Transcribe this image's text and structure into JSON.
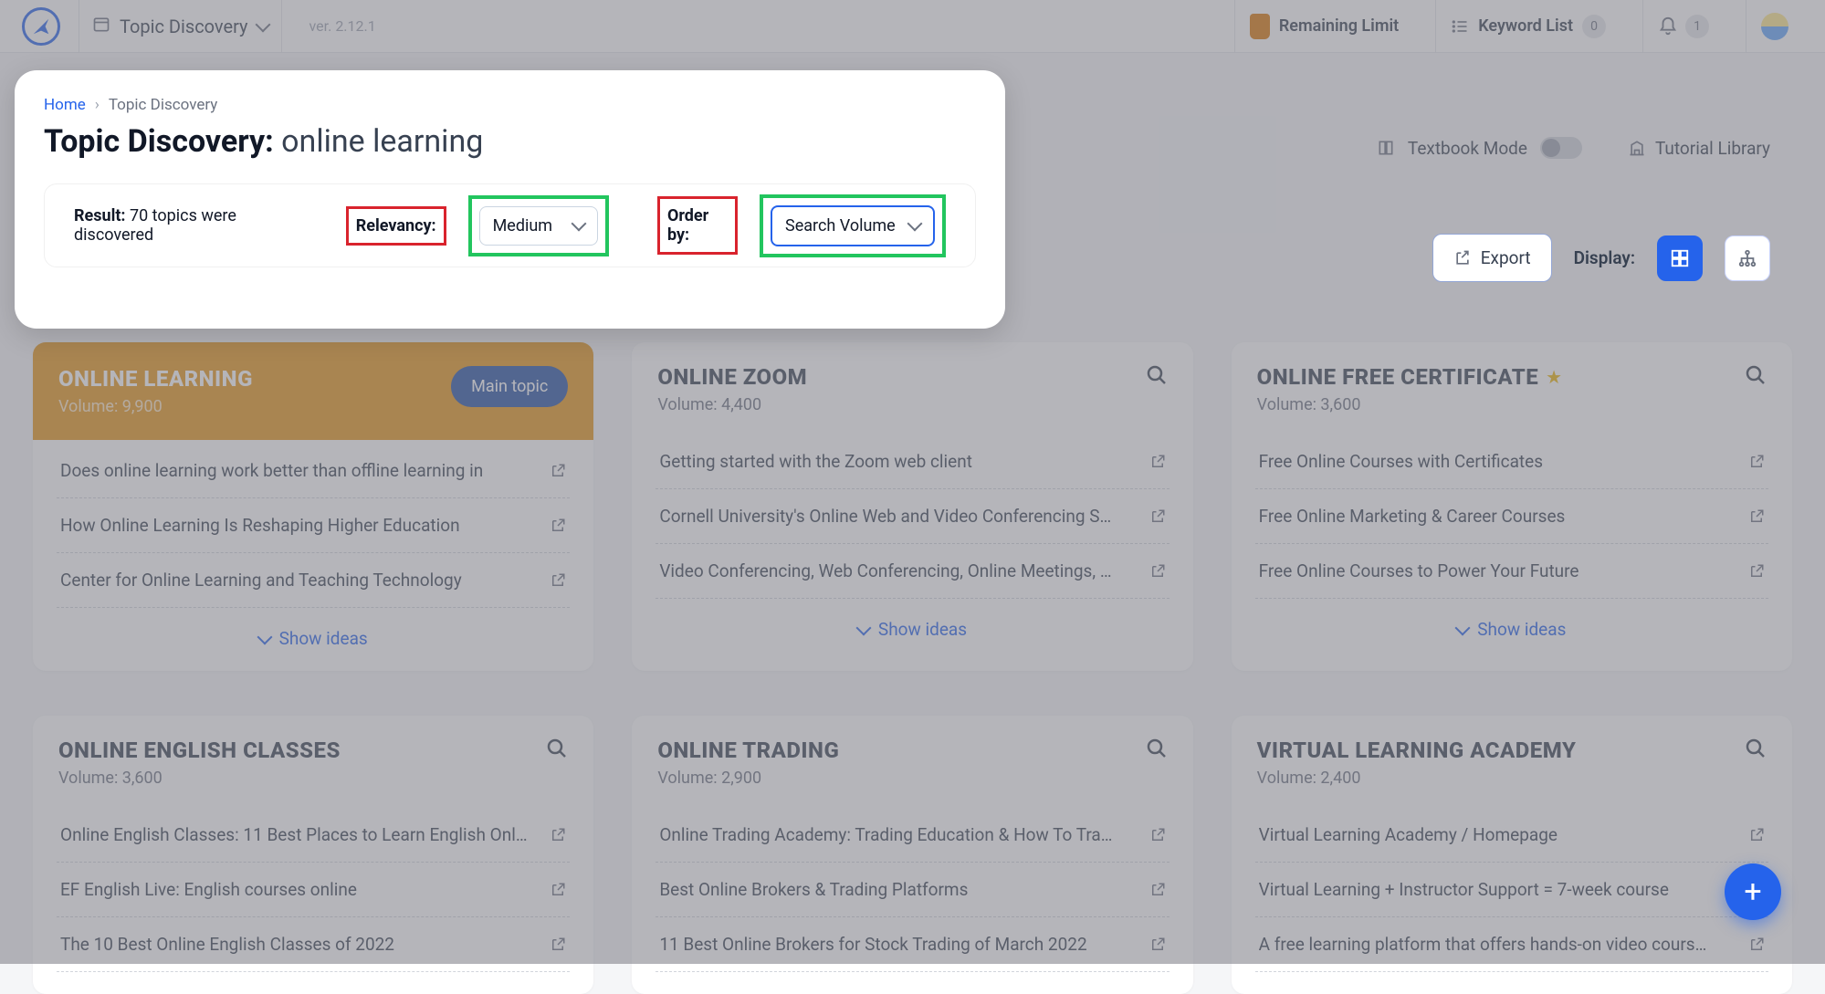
{
  "header": {
    "tool_name": "Topic Discovery",
    "version": "ver. 2.12.1",
    "remaining_limit": "Remaining Limit",
    "keyword_list": "Keyword List",
    "keyword_count": "0",
    "notif_count": "1"
  },
  "top_right": {
    "textbook_mode": "Textbook Mode",
    "tutorial_library": "Tutorial Library"
  },
  "breadcrumb": {
    "home": "Home",
    "current": "Topic Discovery"
  },
  "title": {
    "prefix": "Topic Discovery:",
    "term": "online learning"
  },
  "filters": {
    "result_label": "Result:",
    "result_text": "70 topics were discovered",
    "relevancy_label": "Relevancy:",
    "relevancy_value": "Medium",
    "order_label": "Order by:",
    "order_value": "Search Volume",
    "export": "Export",
    "display": "Display:"
  },
  "cards": [
    {
      "title": "ONLINE LEARNING",
      "volume": "Volume: 9,900",
      "badge": "Main topic",
      "featured": true,
      "items": [
        "Does online learning work better than offline learning in",
        "How Online Learning Is Reshaping Higher Education",
        "Center for Online Learning and Teaching Technology"
      ],
      "show": "Show ideas"
    },
    {
      "title": "ONLINE ZOOM",
      "volume": "Volume: 4,400",
      "items": [
        "Getting started with the Zoom web client",
        "Cornell University's Online Web and Video Conferencing S…",
        "Video Conferencing, Web Conferencing, Online Meetings, …"
      ],
      "show": "Show ideas"
    },
    {
      "title": "ONLINE FREE CERTIFICATE",
      "volume": "Volume: 3,600",
      "starred": true,
      "items": [
        "Free Online Courses with Certificates",
        "Free Online Marketing & Career Courses",
        "Free Online Courses to Power Your Future"
      ],
      "show": "Show ideas"
    }
  ],
  "cards2": [
    {
      "title": "ONLINE ENGLISH CLASSES",
      "volume": "Volume: 3,600",
      "items": [
        "Online English Classes: 11 Best Places to Learn English Onl…",
        "EF English Live: English courses online",
        "The 10 Best Online English Classes of 2022"
      ]
    },
    {
      "title": "ONLINE TRADING",
      "volume": "Volume: 2,900",
      "items": [
        "Online Trading Academy: Trading Education & How To Tra…",
        "Best Online Brokers & Trading Platforms",
        "11 Best Online Brokers for Stock Trading of March 2022"
      ]
    },
    {
      "title": "VIRTUAL LEARNING ACADEMY",
      "volume": "Volume: 2,400",
      "items": [
        "Virtual Learning Academy / Homepage",
        "Virtual Learning + Instructor Support = 7-week course",
        "A free learning platform that offers hands-on video cours…"
      ]
    }
  ]
}
